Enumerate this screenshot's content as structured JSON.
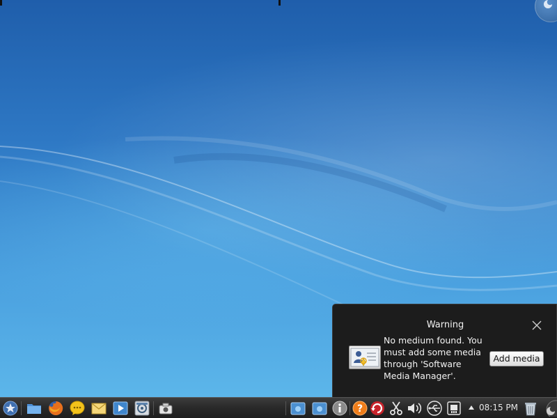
{
  "notification": {
    "title": "Warning",
    "message": "No medium found. You must add some media through 'Software Media Manager'.",
    "action_button": "Add media",
    "close_icon": "close-icon",
    "image_icon": "media-manager-icon"
  },
  "taskbar": {
    "launchers": [
      "application-launcher-icon",
      "file-manager-icon",
      "firefox-icon",
      "chat-icon",
      "mail-icon",
      "media-player-icon",
      "control-center-icon",
      "screenshot-icon"
    ],
    "tray_icons": [
      "folder-view-icon",
      "folder-view-2-icon",
      "info-icon",
      "help-icon",
      "update-icon",
      "clipboard-scissors-icon",
      "volume-icon",
      "usb-icon",
      "network-icon"
    ],
    "clock": "08:15 PM",
    "trash_icon": "trash-icon",
    "panel_toolbox_icon": "panel-toolbox-icon"
  },
  "desktop": {
    "toolbox_icon": "desktop-toolbox-icon"
  },
  "colors": {
    "desktop_top": "#1f5eab",
    "desktop_bottom": "#5cb6ea",
    "notification_bg": "#1c1c1c",
    "taskbar_bg": "#2a2a2a"
  }
}
